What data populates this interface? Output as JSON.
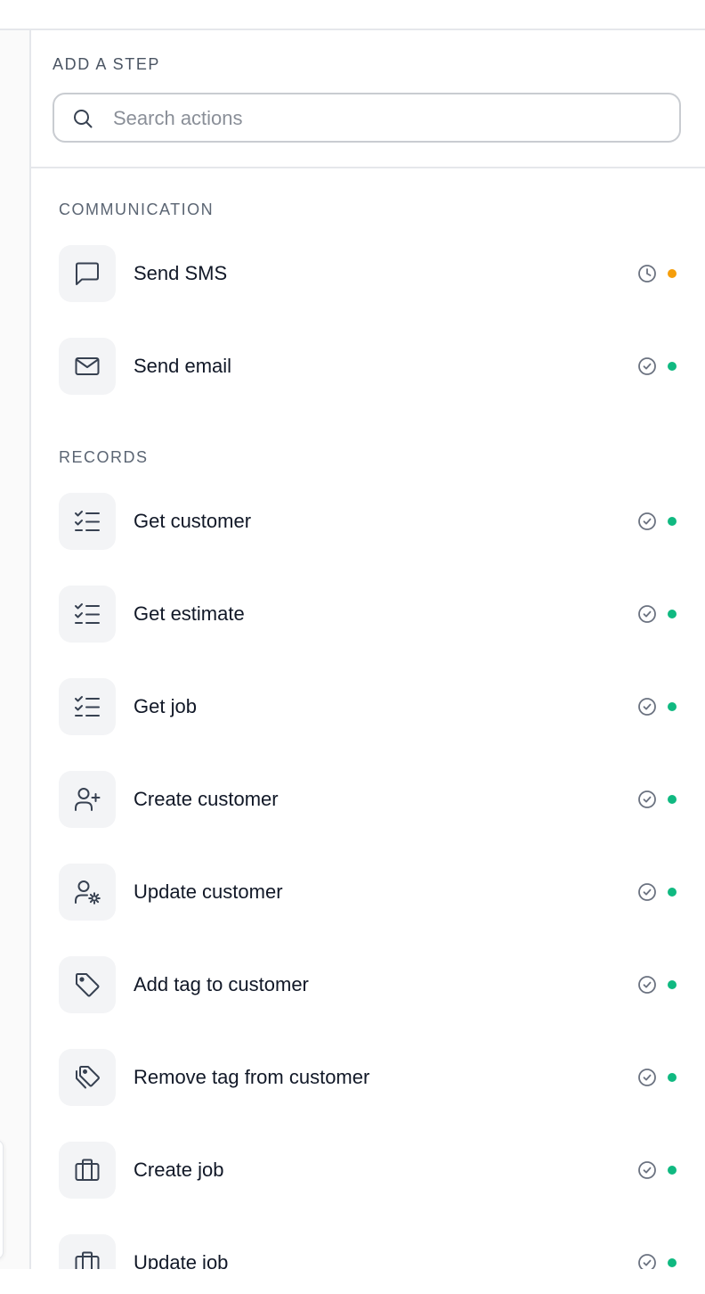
{
  "header": {
    "title": "ADD A STEP",
    "search_placeholder": "Search actions",
    "search_value": ""
  },
  "sections": {
    "communication": "COMMUNICATION",
    "records": "RECORDS"
  },
  "items": {
    "send_sms": {
      "label": "Send SMS",
      "status": "pending",
      "icon": "message-square-icon"
    },
    "send_email": {
      "label": "Send email",
      "status": "ready",
      "icon": "mail-icon"
    },
    "get_customer": {
      "label": "Get customer",
      "status": "ready",
      "icon": "checklist-icon"
    },
    "get_estimate": {
      "label": "Get estimate",
      "status": "ready",
      "icon": "checklist-icon"
    },
    "get_job": {
      "label": "Get job",
      "status": "ready",
      "icon": "checklist-icon"
    },
    "create_customer": {
      "label": "Create customer",
      "status": "ready",
      "icon": "user-plus-icon"
    },
    "update_customer": {
      "label": "Update customer",
      "status": "ready",
      "icon": "user-cog-icon"
    },
    "add_tag": {
      "label": "Add tag to customer",
      "status": "ready",
      "icon": "tag-icon"
    },
    "remove_tag": {
      "label": "Remove tag from customer",
      "status": "ready",
      "icon": "tags-icon"
    },
    "create_job": {
      "label": "Create job",
      "status": "ready",
      "icon": "briefcase-icon"
    },
    "update_job": {
      "label": "Update job",
      "status": "ready",
      "icon": "briefcase-icon"
    }
  },
  "colors": {
    "ready_dot": "#10b981",
    "pending_dot": "#f59e0b",
    "icon_stroke": "#374151",
    "status_icon_stroke": "#6b7280"
  }
}
